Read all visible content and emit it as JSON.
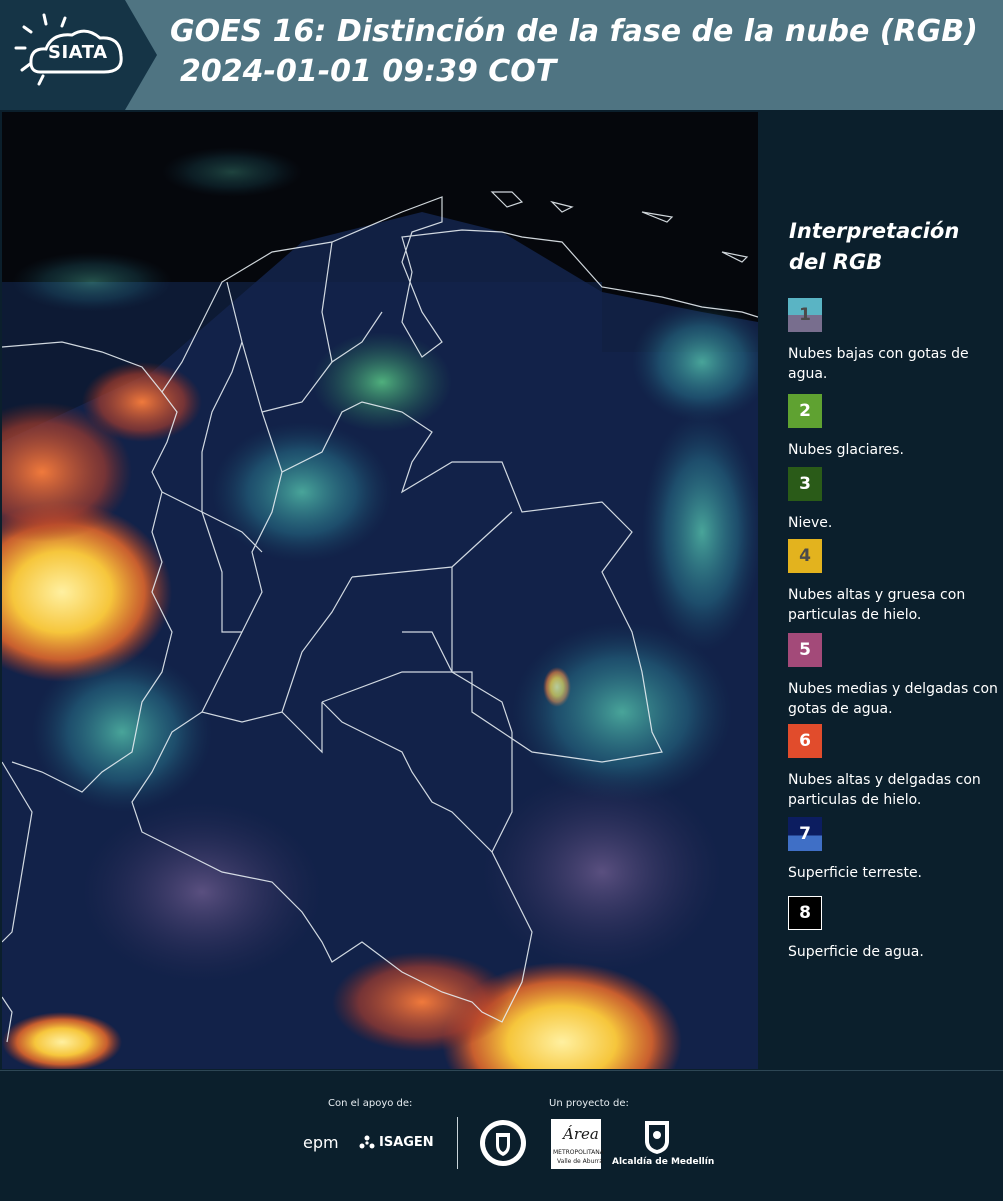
{
  "logo": {
    "text": "SIATA"
  },
  "header": {
    "title_line1": "GOES 16: Distinción de la fase de la nube (RGB)",
    "title_line2": "2024-01-01 09:39 COT"
  },
  "legend": {
    "title": "Interpretación del RGB",
    "items": [
      {
        "number": "1",
        "label": "Nubes bajas con gotas de agua.",
        "color_top": "#5ab4c4",
        "color_bottom": "#786e8e",
        "number_color": "#4a4a4a"
      },
      {
        "number": "2",
        "label": "Nubes glaciares.",
        "color_top": "#5fa231",
        "color_bottom": "#5fa231",
        "number_color": "#ffffff"
      },
      {
        "number": "3",
        "label": "Nieve.",
        "color_top": "#2a5b18",
        "color_bottom": "#2a5b18",
        "number_color": "#ffffff"
      },
      {
        "number": "4",
        "label": "Nubes altas y gruesa con particulas de hielo.",
        "color_top": "#e3b31e",
        "color_bottom": "#e3b31e",
        "number_color": "#4a4a4a"
      },
      {
        "number": "5",
        "label": "Nubes medias y delgadas con gotas de agua.",
        "color_top": "#a34a79",
        "color_bottom": "#a34a79",
        "number_color": "#ffffff"
      },
      {
        "number": "6",
        "label": "Nubes altas y delgadas con particulas de hielo.",
        "color_top": "#e14c2c",
        "color_bottom": "#e14c2c",
        "number_color": "#ffffff"
      },
      {
        "number": "7",
        "label": "Superficie terreste.",
        "color_top": "#0c1d60",
        "color_bottom": "#3f6fc6",
        "number_color": "#ffffff"
      },
      {
        "number": "8",
        "label": "Superficie de agua.",
        "color_top": "#000000",
        "color_bottom": "#000000",
        "number_color": "#ffffff"
      }
    ]
  },
  "footer": {
    "support_label": "Con el apoyo de:",
    "project_label": "Un proyecto de:",
    "sponsors": {
      "epm": "epm",
      "isagen": "ISAGEN",
      "metropolitana_name": "Área",
      "metropolitana_sub": "METROPOLITANA",
      "metropolitana_sub2": "Valle de Aburrá",
      "alcaldia": "Alcaldía de Medellín"
    }
  },
  "colors": {
    "header_bg": "#4f7482",
    "logo_bg": "#153446",
    "page_bg": "#0b1f2c"
  }
}
